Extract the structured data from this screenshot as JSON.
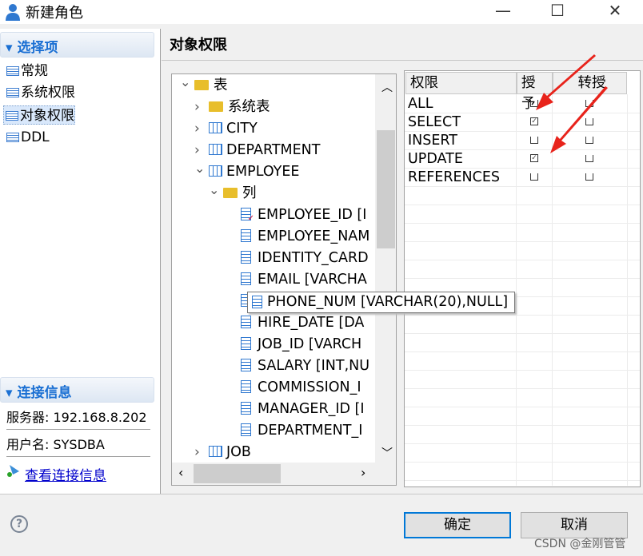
{
  "window": {
    "title": "新建角色",
    "minimize": "—",
    "maximize": "☐",
    "close": "✕"
  },
  "sidebar": {
    "options_header": "选择项",
    "items": [
      {
        "label": "常规"
      },
      {
        "label": "系统权限"
      },
      {
        "label": "对象权限",
        "selected": true
      },
      {
        "label": "DDL"
      }
    ],
    "connection_header": "连接信息",
    "server": "服务器: 192.168.8.202",
    "username": "用户名: SYSDBA",
    "view_link": "查看连接信息"
  },
  "main": {
    "title": "对象权限",
    "tree": [
      {
        "label": "表",
        "depth": 0,
        "icon": "folder-open-icon",
        "toggle": "expanded"
      },
      {
        "label": "系统表",
        "depth": 1,
        "icon": "folder-icon",
        "toggle": "collapsed"
      },
      {
        "label": "CITY",
        "depth": 1,
        "icon": "table-icon",
        "toggle": "collapsed"
      },
      {
        "label": "DEPARTMENT",
        "depth": 1,
        "icon": "table-icon",
        "toggle": "collapsed"
      },
      {
        "label": "EMPLOYEE",
        "depth": 1,
        "icon": "table-icon",
        "toggle": "expanded"
      },
      {
        "label": "列",
        "depth": 2,
        "icon": "folder-open-icon",
        "toggle": "expanded"
      },
      {
        "label": "EMPLOYEE_ID [I",
        "depth": 3,
        "icon": "column-key-icon"
      },
      {
        "label": "EMPLOYEE_NAM",
        "depth": 3,
        "icon": "column-icon"
      },
      {
        "label": "IDENTITY_CARD",
        "depth": 3,
        "icon": "column-icon"
      },
      {
        "label": "EMAIL [VARCHA",
        "depth": 3,
        "icon": "column-icon"
      },
      {
        "label": "PHONE_NUM [VARCHAR(20),NULL]",
        "depth": 3,
        "icon": "column-icon"
      },
      {
        "label": "HIRE_DATE [DA",
        "depth": 3,
        "icon": "column-icon"
      },
      {
        "label": "JOB_ID [VARCH",
        "depth": 3,
        "icon": "column-icon"
      },
      {
        "label": "SALARY [INT,NU",
        "depth": 3,
        "icon": "column-icon"
      },
      {
        "label": "COMMISSION_I",
        "depth": 3,
        "icon": "column-icon"
      },
      {
        "label": "MANAGER_ID [I",
        "depth": 3,
        "icon": "column-icon"
      },
      {
        "label": "DEPARTMENT_I",
        "depth": 3,
        "icon": "column-icon"
      },
      {
        "label": "JOB",
        "depth": 1,
        "icon": "table-icon",
        "toggle": "collapsed"
      }
    ],
    "tooltip": "PHONE_NUM [VARCHAR(20),NULL]",
    "permissions": {
      "headers": [
        "权限",
        "授予.",
        "转授"
      ],
      "rows": [
        {
          "name": "ALL",
          "grant": false,
          "transfer": false
        },
        {
          "name": "SELECT",
          "grant": true,
          "transfer": false
        },
        {
          "name": "INSERT",
          "grant": false,
          "transfer": false
        },
        {
          "name": "UPDATE",
          "grant": true,
          "transfer": false
        },
        {
          "name": "REFERENCES",
          "grant": false,
          "transfer": false
        }
      ]
    }
  },
  "footer": {
    "ok": "确定",
    "cancel": "取消",
    "help": "?",
    "watermark": "CSDN @金刚管管"
  },
  "colors": {
    "accent": "#1a6fd3",
    "arrow": "#e8231b"
  }
}
